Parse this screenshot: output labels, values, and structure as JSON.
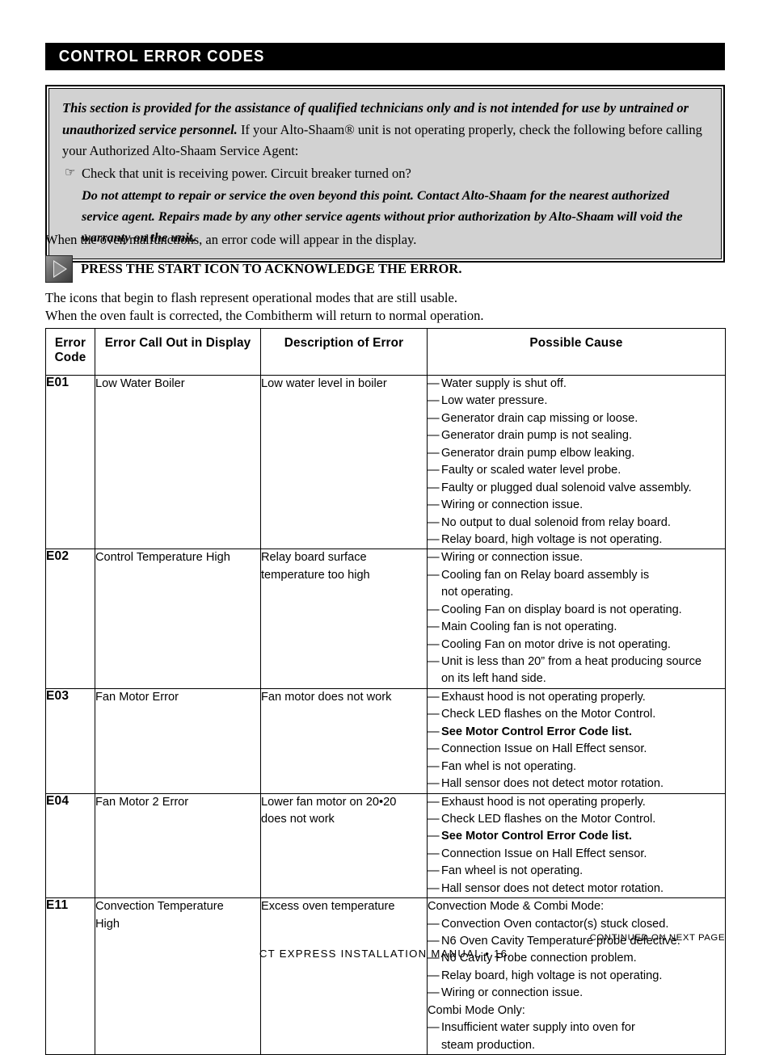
{
  "header": {
    "section_title": "CONTROL ERROR CODES"
  },
  "warning_box": {
    "line1_bold_italic": "This section is provided for the assistance of qualified technicians only and is not intended for use by untrained or unauthorized service personnel.",
    "line1_rest": " If your Alto-Shaam® unit is not operating properly, check the following before calling your Authorized Alto-Shaam Service Agent:",
    "bullet_icon": "pointing-hand-bullet",
    "bullet_text": "Check that unit is receiving power. Circuit breaker turned on?",
    "sub_paragraph": "Do not attempt to repair or service the oven beyond this point. Contact Alto-Shaam for the nearest authorized service agent. Repairs made by any other service agents without prior authorization by Alto-Shaam will void the warranty on the unit."
  },
  "body": {
    "intro": "When the oven malfunctions, an error code will appear in the display.",
    "press_icon": "start-play-icon",
    "press_instruction": "PRESS THE START ICON TO ACKNOWLEDGE THE ERROR.",
    "tail_line1": "The icons that begin to flash represent operational modes that are still usable.",
    "tail_line2": "When the oven fault is corrected, the Combitherm will return to normal operation."
  },
  "table": {
    "headers": {
      "code": "Error\nCode",
      "code_line1": "Error",
      "code_line2": "Code",
      "call_out": "Error Call Out in Display",
      "description": "Description of Error",
      "cause": "Possible Cause"
    },
    "rows": [
      {
        "code": "E01",
        "call_out": "Low Water Boiler",
        "description": "Low water level in boiler",
        "causes": [
          {
            "text": "Water supply is shut off.",
            "bold": false
          },
          {
            "text": "Low water pressure.",
            "bold": false
          },
          {
            "text": "Generator drain cap missing or loose.",
            "bold": false
          },
          {
            "text": "Generator drain pump is not sealing.",
            "bold": false
          },
          {
            "text": "Generator drain pump elbow leaking.",
            "bold": false
          },
          {
            "text": "Faulty or scaled water level probe.",
            "bold": false
          },
          {
            "text": "Faulty or plugged dual solenoid valve assembly.",
            "bold": false
          },
          {
            "text": "Wiring or connection issue.",
            "bold": false
          },
          {
            "text": "No output to dual solenoid from relay board.",
            "bold": false
          },
          {
            "text": "Relay board, high voltage is not operating.",
            "bold": false
          }
        ]
      },
      {
        "code": "E02",
        "call_out": "Control Temperature High",
        "description": "Relay board surface\ntemperature too high",
        "description_line1": "Relay board surface",
        "description_line2": "temperature too high",
        "causes": [
          {
            "text": "Wiring or connection issue.",
            "bold": false
          },
          {
            "text": "Cooling fan on Relay board assembly is",
            "cont": "not operating.",
            "bold": false
          },
          {
            "text": "Cooling Fan on display board is not operating.",
            "bold": false
          },
          {
            "text": "Main Cooling fan is not operating.",
            "bold": false
          },
          {
            "text": "Cooling Fan on motor drive is not operating.",
            "bold": false
          },
          {
            "text": "Unit is less than 20” from a heat producing source",
            "cont": "on its left hand side.",
            "bold": false
          }
        ]
      },
      {
        "code": "E03",
        "call_out": "Fan Motor Error",
        "description": "Fan motor does not work",
        "causes": [
          {
            "text": "Exhaust hood is not operating properly.",
            "bold": false
          },
          {
            "text": "Check LED flashes on the Motor Control.",
            "bold": false
          },
          {
            "text": "See Motor Control Error Code list.",
            "bold": true
          },
          {
            "text": "Connection Issue on Hall Effect sensor.",
            "bold": false
          },
          {
            "text": "Fan whel is not operating.",
            "bold": false
          },
          {
            "text": "Hall sensor does not detect motor rotation.",
            "bold": false
          }
        ]
      },
      {
        "code": "E04",
        "call_out": "Fan Motor 2 Error",
        "description": "Lower fan motor on 20•20\ndoes not work",
        "description_line1": "Lower fan motor on 20•20",
        "description_line2": "does not work",
        "causes": [
          {
            "text": "Exhaust hood is not operating properly.",
            "bold": false
          },
          {
            "text": "Check LED flashes on the Motor Control.",
            "bold": false
          },
          {
            "text": "See Motor Control Error Code list.",
            "bold": true
          },
          {
            "text": "Connection Issue on Hall Effect sensor.",
            "bold": false
          },
          {
            "text": "Fan wheel is not operating.",
            "bold": false
          },
          {
            "text": "Hall sensor does not detect motor rotation.",
            "bold": false
          }
        ]
      },
      {
        "code": "E11",
        "call_out": "Convection Temperature\nHigh",
        "call_out_line1": "Convection Temperature",
        "call_out_line2": "High",
        "description": "Excess oven temperature",
        "cause_heading_1": "Convection Mode & Combi Mode:",
        "cause_heading_2": "Combi Mode Only:",
        "causes": [
          {
            "text": "Convection Oven contactor(s) stuck closed.",
            "bold": false
          },
          {
            "text": "N6 Oven Cavity Temperature probe defective.",
            "bold": false
          },
          {
            "text": "N6 Cavity Probe connection problem.",
            "bold": false
          },
          {
            "text": "Relay board, high voltage is not operating.",
            "bold": false
          },
          {
            "text": "Wiring or connection issue.",
            "bold": false
          }
        ],
        "causes2": [
          {
            "text": "Insufficient water supply into oven for",
            "cont": "steam production.",
            "bold": false
          }
        ]
      }
    ],
    "dash": "—"
  },
  "footer": {
    "continued": "CONTINUED ON NEXT PAGE",
    "manual_line": "CT EXPRESS INSTALLATION MANUAL • 16."
  }
}
